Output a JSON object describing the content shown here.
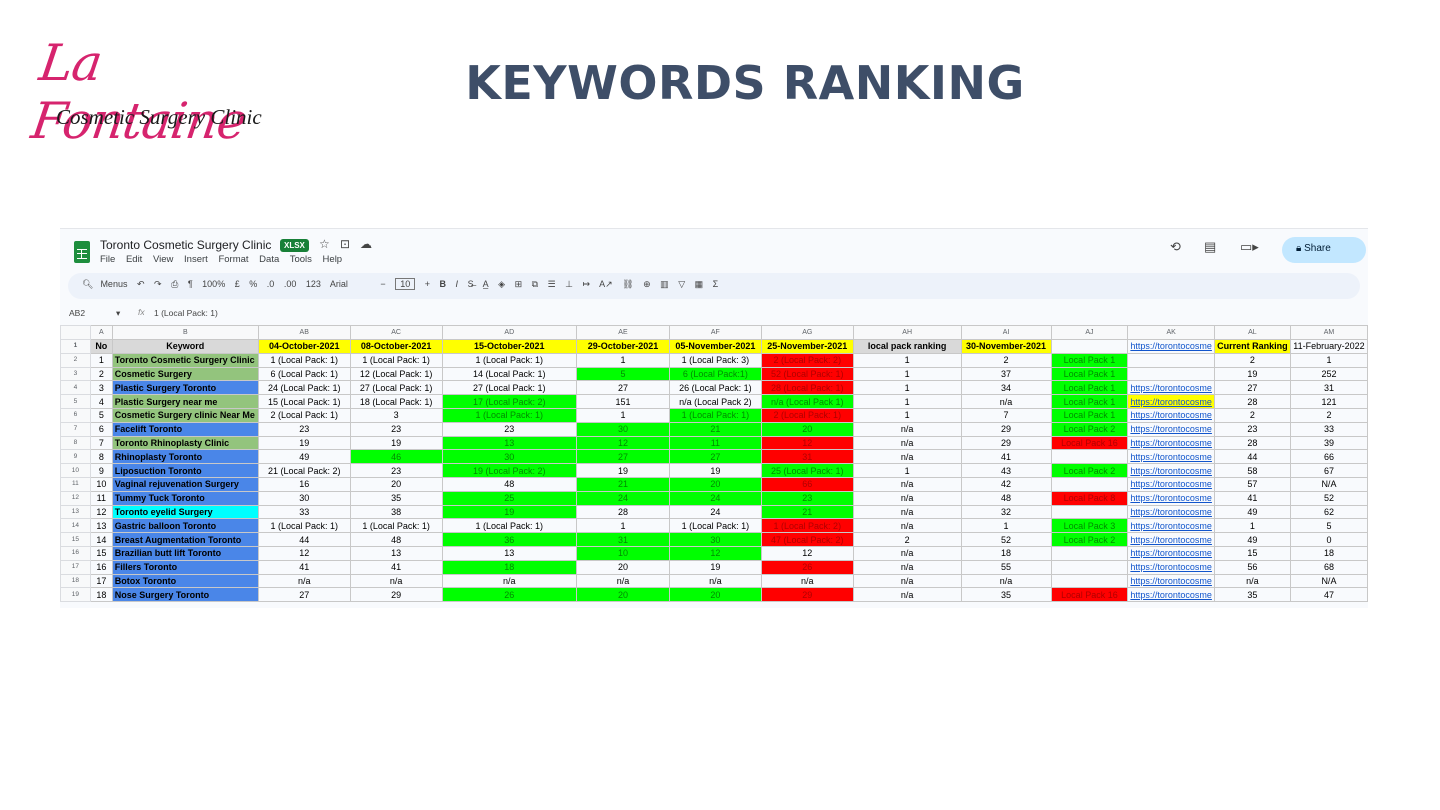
{
  "logo": {
    "script": "La Fontaine",
    "subtitle": "Cosmetic Surgery Clinic"
  },
  "slide_title": "KEYWORDS RANKING",
  "sheet": {
    "doc_title": "Toronto Cosmetic Surgery Clinic",
    "badge": "XLSX",
    "menus": [
      "File",
      "Edit",
      "View",
      "Insert",
      "Format",
      "Data",
      "Tools",
      "Help"
    ],
    "share_label": "Share",
    "toolbar": {
      "menus": "Menus",
      "zoom": "100%",
      "currency": "£",
      "percent": "%",
      "dec_less": ".0",
      "dec_more": ".00",
      "format_123": "123",
      "font": "Arial",
      "font_size": "10",
      "bold": "B",
      "italic": "I"
    },
    "name_box": "AB2",
    "formula_value": "1 (Local Pack: 1)"
  },
  "colors": {
    "green": "#00ff00",
    "red": "#ff0000",
    "yellow": "#ffff00",
    "keyword_green": "#93c47d",
    "keyword_blue": "#4a86e8",
    "keyword_cyan": "#00ffff",
    "title": "#3e4e68",
    "logo": "#d6246e"
  },
  "columns": [
    "A",
    "B",
    "AB",
    "AC",
    "AD",
    "AE",
    "AF",
    "AG",
    "AH",
    "AI",
    "AJ",
    "AK",
    "AL",
    "AM"
  ],
  "header_row": [
    "No",
    "Keyword",
    "04-October-2021",
    "08-October-2021",
    "15-October-2021",
    "29-October-2021",
    "05-November-2021",
    "25-November-2021",
    "local pack ranking",
    "30-November-2021",
    "",
    "https://torontocosme",
    "Current Ranking",
    "11-February-2022"
  ],
  "rows": [
    {
      "rn": "2",
      "cells": [
        "1",
        "Toronto Cosmetic Surgery Clinic",
        "1 (Local Pack: 1)",
        "1 (Local Pack: 1)",
        "1 (Local Pack: 1)",
        "1",
        "1 (Local Pack: 3)",
        "2 (Local Pack: 2)",
        "1",
        "2",
        "Local Pack 1",
        "",
        "2",
        "1"
      ],
      "fills": [
        "",
        "kg",
        "",
        "",
        "",
        "",
        "",
        "r",
        "",
        "",
        "g",
        "",
        "",
        ""
      ]
    },
    {
      "rn": "3",
      "cells": [
        "2",
        "Cosmetic Surgery",
        "6 (Local Pack: 1)",
        "12 (Local Pack: 1)",
        "14 (Local Pack: 1)",
        "5",
        "6 (Local Pack:1)",
        "52 (Local Pack: 1)",
        "1",
        "37",
        "Local Pack 1",
        "",
        "19",
        "252"
      ],
      "fills": [
        "",
        "kg",
        "",
        "",
        "",
        "g",
        "g",
        "r",
        "",
        "",
        "g",
        "",
        "",
        ""
      ]
    },
    {
      "rn": "4",
      "cells": [
        "3",
        "Plastic Surgery Toronto",
        "24 (Local Pack: 1)",
        "27 (Local Pack: 1)",
        "27 (Local Pack: 1)",
        "27",
        "26 (Local Pack: 1)",
        "28 (Local Pack: 1)",
        "1",
        "34",
        "Local Pack 1",
        "https://torontocosme",
        "27",
        "31"
      ],
      "fills": [
        "",
        "kb",
        "",
        "",
        "",
        "",
        "",
        "r",
        "",
        "",
        "g",
        "",
        "",
        ""
      ]
    },
    {
      "rn": "5",
      "cells": [
        "4",
        "Plastic Surgery near me",
        "15 (Local Pack: 1)",
        "18 (Local Pack: 1)",
        "17 (Local Pack: 2)",
        "151",
        "n/a (Local Pack 2)",
        "n/a (Local Pack 1)",
        "1",
        "n/a",
        "Local Pack 1",
        "https://torontocosme",
        "28",
        "121"
      ],
      "fills": [
        "",
        "kg",
        "",
        "",
        "g",
        "",
        "",
        "g",
        "",
        "",
        "g",
        "y",
        "",
        ""
      ]
    },
    {
      "rn": "6",
      "cells": [
        "5",
        "Cosmetic Surgery clinic Near Me",
        "2 (Local Pack: 1)",
        "3",
        "1 (Local Pack: 1)",
        "1",
        "1 (Local Pack: 1)",
        "2 (Local Pack: 1)",
        "1",
        "7",
        "Local Pack 1",
        "https://torontocosme",
        "2",
        "2"
      ],
      "fills": [
        "",
        "kg",
        "",
        "",
        "g",
        "",
        "g",
        "r",
        "",
        "",
        "g",
        "",
        "",
        ""
      ]
    },
    {
      "rn": "7",
      "cells": [
        "6",
        "Facelift Toronto",
        "23",
        "23",
        "23",
        "30",
        "21",
        "20",
        "n/a",
        "29",
        "Local Pack 2",
        "https://torontocosme",
        "23",
        "33"
      ],
      "fills": [
        "",
        "kb",
        "",
        "",
        "",
        "g",
        "g",
        "g",
        "",
        "",
        "g",
        "",
        "",
        ""
      ]
    },
    {
      "rn": "8",
      "cells": [
        "7",
        "Toronto Rhinoplasty Clinic",
        "19",
        "19",
        "13",
        "12",
        "11",
        "12",
        "n/a",
        "29",
        "Local Pack 16",
        "https://torontocosme",
        "28",
        "39"
      ],
      "fills": [
        "",
        "kg",
        "",
        "",
        "g",
        "g",
        "g",
        "r",
        "",
        "",
        "r",
        "",
        "",
        ""
      ]
    },
    {
      "rn": "9",
      "cells": [
        "8",
        "Rhinoplasty Toronto",
        "49",
        "46",
        "30",
        "27",
        "27",
        "31",
        "n/a",
        "41",
        "",
        "https://torontocosme",
        "44",
        "66"
      ],
      "fills": [
        "",
        "kb",
        "",
        "g",
        "g",
        "g",
        "g",
        "r",
        "",
        "",
        "",
        "",
        "",
        ""
      ]
    },
    {
      "rn": "10",
      "cells": [
        "9",
        "Liposuction Toronto",
        "21 (Local Pack: 2)",
        "23",
        "19 (Local Pack: 2)",
        "19",
        "19",
        "25 (Local Pack: 1)",
        "1",
        "43",
        "Local Pack 2",
        "https://torontocosme",
        "58",
        "67"
      ],
      "fills": [
        "",
        "kb",
        "",
        "",
        "g",
        "",
        "",
        "g",
        "",
        "",
        "g",
        "",
        "",
        ""
      ]
    },
    {
      "rn": "11",
      "cells": [
        "10",
        "Vaginal rejuvenation Surgery",
        "16",
        "20",
        "48",
        "21",
        "20",
        "66",
        "n/a",
        "42",
        "",
        "https://torontocosme",
        "57",
        "N/A"
      ],
      "fills": [
        "",
        "kb",
        "",
        "",
        "",
        "g",
        "g",
        "r",
        "",
        "",
        "",
        "",
        "",
        ""
      ]
    },
    {
      "rn": "12",
      "cells": [
        "11",
        "Tummy Tuck Toronto",
        "30",
        "35",
        "25",
        "24",
        "24",
        "23",
        "n/a",
        "48",
        "Local Pack 8",
        "https://torontocosme",
        "41",
        "52"
      ],
      "fills": [
        "",
        "kb",
        "",
        "",
        "g",
        "g",
        "g",
        "g",
        "",
        "",
        "r",
        "",
        "",
        ""
      ]
    },
    {
      "rn": "13",
      "cells": [
        "12",
        "Toronto eyelid Surgery",
        "33",
        "38",
        "19",
        "28",
        "24",
        "21",
        "n/a",
        "32",
        "",
        "https://torontocosme",
        "49",
        "62"
      ],
      "fills": [
        "",
        "kc",
        "",
        "",
        "g",
        "",
        "",
        "g",
        "",
        "",
        "",
        "",
        "",
        ""
      ]
    },
    {
      "rn": "14",
      "cells": [
        "13",
        "Gastric balloon Toronto",
        "1 (Local Pack: 1)",
        "1 (Local Pack: 1)",
        "1 (Local Pack: 1)",
        "1",
        "1 (Local Pack: 1)",
        "1 (Local Pack: 2)",
        "n/a",
        "1",
        "Local Pack 3",
        "https://torontocosme",
        "1",
        "5"
      ],
      "fills": [
        "",
        "kb",
        "",
        "",
        "",
        "",
        "",
        "r",
        "",
        "",
        "g",
        "",
        "",
        ""
      ]
    },
    {
      "rn": "15",
      "cells": [
        "14",
        "Breast Augmentation Toronto",
        "44",
        "48",
        "36",
        "31",
        "30",
        "47 (Local Pack: 2)",
        "2",
        "52",
        "Local Pack 2",
        "https://torontocosme",
        "49",
        "0"
      ],
      "fills": [
        "",
        "kb",
        "",
        "",
        "g",
        "g",
        "g",
        "r",
        "",
        "",
        "g",
        "",
        "",
        ""
      ]
    },
    {
      "rn": "16",
      "cells": [
        "15",
        "Brazilian butt lift Toronto",
        "12",
        "13",
        "13",
        "10",
        "12",
        "12",
        "n/a",
        "18",
        "",
        "https://torontocosme",
        "15",
        "18"
      ],
      "fills": [
        "",
        "kb",
        "",
        "",
        "",
        "g",
        "g",
        "",
        "",
        "",
        "",
        "",
        "",
        ""
      ]
    },
    {
      "rn": "17",
      "cells": [
        "16",
        "Fillers Toronto",
        "41",
        "41",
        "18",
        "20",
        "19",
        "26",
        "n/a",
        "55",
        "",
        "https://torontocosme",
        "56",
        "68"
      ],
      "fills": [
        "",
        "kb",
        "",
        "",
        "g",
        "",
        "",
        "r",
        "",
        "",
        "",
        "",
        "",
        ""
      ]
    },
    {
      "rn": "18",
      "cells": [
        "17",
        "Botox Toronto",
        "n/a",
        "n/a",
        "n/a",
        "n/a",
        "n/a",
        "n/a",
        "n/a",
        "n/a",
        "",
        "https://torontocosme",
        "n/a",
        "N/A"
      ],
      "fills": [
        "",
        "kb",
        "",
        "",
        "",
        "",
        "",
        "",
        "",
        "",
        "",
        "",
        "",
        ""
      ]
    },
    {
      "rn": "19",
      "cells": [
        "18",
        "Nose Surgery Toronto",
        "27",
        "29",
        "26",
        "20",
        "20",
        "29",
        "n/a",
        "35",
        "Local Pack 16",
        "https://torontocosme",
        "35",
        "47"
      ],
      "fills": [
        "",
        "kb",
        "",
        "",
        "g",
        "g",
        "g",
        "r",
        "",
        "",
        "r",
        "",
        "",
        ""
      ]
    }
  ]
}
